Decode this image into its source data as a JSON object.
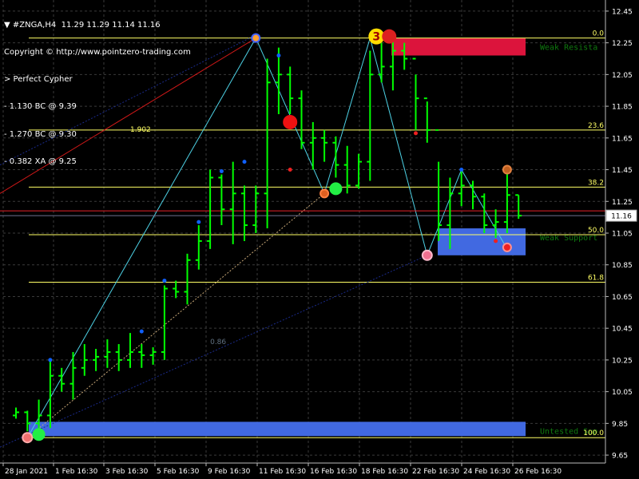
{
  "header": {
    "symbol_line": "#ZNGA,H4  11.29 11.29 11.14 11.16",
    "copyright": "Copyright © http://www.pointzero-trading.com",
    "pattern": "> Perfect Cypher",
    "lines": [
      "- 1.130 BC @ 9.39",
      "- 1.270 BC @ 9.30",
      "- 0.382 XA @ 9.25"
    ]
  },
  "colors": {
    "background": "#000000",
    "grid": "#3a3a3a",
    "candle": "#00ff00",
    "fib": "#ffff66",
    "price_line": "#e8202a",
    "resistance": "#dc143c",
    "support": "#4169e1",
    "zone_text": "#0f7a0f",
    "cyan": "#4dd2e6"
  },
  "chart_data": {
    "type": "candlestick",
    "symbol": "#ZNGA",
    "timeframe": "H4",
    "ohlc_header": {
      "open": 11.29,
      "high": 11.29,
      "low": 11.14,
      "close": 11.16
    },
    "current_price": 11.16,
    "ylim": [
      9.6,
      12.52
    ],
    "y_ticks": [
      12.45,
      12.25,
      12.05,
      11.85,
      11.65,
      11.45,
      11.25,
      11.05,
      10.85,
      10.65,
      10.45,
      10.25,
      10.05,
      9.85,
      9.65
    ],
    "x_ticks": [
      "28 Jan 2021",
      "1 Feb 16:30",
      "3 Feb 16:30",
      "5 Feb 16:30",
      "9 Feb 16:30",
      "11 Feb 16:30",
      "16 Feb 16:30",
      "18 Feb 16:30",
      "22 Feb 16:30",
      "24 Feb 16:30",
      "26 Feb 16:30"
    ],
    "fib_levels": [
      {
        "label": "0.0",
        "price": 12.28
      },
      {
        "label": "23.6",
        "price": 11.7
      },
      {
        "label": "38.2",
        "price": 11.34
      },
      {
        "label": "50.0",
        "price": 11.04
      },
      {
        "label": "61.8",
        "price": 10.74
      },
      {
        "label": "100.0",
        "price": 9.76
      }
    ],
    "zones": [
      {
        "text": "Weak Resista",
        "top": 12.28,
        "bottom": 12.17,
        "color": "resistance"
      },
      {
        "text": "Weak Support",
        "top": 11.08,
        "bottom": 10.91,
        "color": "support"
      },
      {
        "text": "Untested Sup",
        "top": 9.86,
        "bottom": 9.77,
        "color": "support"
      }
    ],
    "annotations": [
      {
        "text": "1.902",
        "x": 10,
        "price": 11.69
      },
      {
        "text": "0.86",
        "x": 17,
        "price": 10.35
      }
    ],
    "candles": [
      {
        "o": 9.9,
        "h": 9.95,
        "l": 9.88,
        "c": 9.92
      },
      {
        "o": 9.92,
        "h": 9.93,
        "l": 9.8,
        "c": 9.85
      },
      {
        "o": 9.85,
        "h": 10.0,
        "l": 9.75,
        "c": 9.9
      },
      {
        "o": 9.9,
        "h": 10.25,
        "l": 9.82,
        "c": 10.15
      },
      {
        "o": 10.15,
        "h": 10.2,
        "l": 10.05,
        "c": 10.1
      },
      {
        "o": 10.1,
        "h": 10.3,
        "l": 10.0,
        "c": 10.2
      },
      {
        "o": 10.2,
        "h": 10.35,
        "l": 10.15,
        "c": 10.25
      },
      {
        "o": 10.25,
        "h": 10.32,
        "l": 10.18,
        "c": 10.27
      },
      {
        "o": 10.27,
        "h": 10.38,
        "l": 10.2,
        "c": 10.3
      },
      {
        "o": 10.3,
        "h": 10.35,
        "l": 10.18,
        "c": 10.25
      },
      {
        "o": 10.25,
        "h": 10.42,
        "l": 10.2,
        "c": 10.3
      },
      {
        "o": 10.3,
        "h": 10.35,
        "l": 10.2,
        "c": 10.28
      },
      {
        "o": 10.28,
        "h": 10.33,
        "l": 10.22,
        "c": 10.3
      },
      {
        "o": 10.3,
        "h": 10.72,
        "l": 10.25,
        "c": 10.7
      },
      {
        "o": 10.7,
        "h": 10.75,
        "l": 10.64,
        "c": 10.68
      },
      {
        "o": 10.68,
        "h": 10.92,
        "l": 10.6,
        "c": 10.88
      },
      {
        "o": 10.88,
        "h": 11.1,
        "l": 10.82,
        "c": 11.0
      },
      {
        "o": 11.0,
        "h": 11.45,
        "l": 10.95,
        "c": 11.4
      },
      {
        "o": 11.4,
        "h": 11.42,
        "l": 11.1,
        "c": 11.2
      },
      {
        "o": 11.2,
        "h": 11.5,
        "l": 10.98,
        "c": 11.3
      },
      {
        "o": 11.3,
        "h": 11.35,
        "l": 11.0,
        "c": 11.1
      },
      {
        "o": 11.1,
        "h": 11.35,
        "l": 11.05,
        "c": 11.3
      },
      {
        "o": 11.3,
        "h": 12.15,
        "l": 11.08,
        "c": 12.0
      },
      {
        "o": 12.0,
        "h": 12.22,
        "l": 11.8,
        "c": 12.05
      },
      {
        "o": 12.05,
        "h": 12.1,
        "l": 11.8,
        "c": 11.9
      },
      {
        "o": 11.9,
        "h": 11.95,
        "l": 11.58,
        "c": 11.62
      },
      {
        "o": 11.62,
        "h": 11.75,
        "l": 11.45,
        "c": 11.65
      },
      {
        "o": 11.65,
        "h": 11.7,
        "l": 11.5,
        "c": 11.62
      },
      {
        "o": 11.62,
        "h": 11.66,
        "l": 11.4,
        "c": 11.48
      },
      {
        "o": 11.48,
        "h": 11.6,
        "l": 11.3,
        "c": 11.35
      },
      {
        "o": 11.35,
        "h": 11.55,
        "l": 11.33,
        "c": 11.5
      },
      {
        "o": 11.5,
        "h": 12.2,
        "l": 11.38,
        "c": 12.05
      },
      {
        "o": 12.05,
        "h": 12.25,
        "l": 12.0,
        "c": 12.1
      },
      {
        "o": 12.1,
        "h": 12.28,
        "l": 11.95,
        "c": 12.2
      },
      {
        "o": 12.2,
        "h": 12.25,
        "l": 12.08,
        "c": 12.15
      },
      {
        "o": 12.15,
        "h": 12.05,
        "l": 11.7,
        "c": 11.9
      },
      {
        "o": 11.9,
        "h": 11.88,
        "l": 11.62,
        "c": 11.7
      },
      {
        "o": 11.7,
        "h": 11.5,
        "l": 11.0,
        "c": 11.1
      },
      {
        "o": 11.1,
        "h": 11.4,
        "l": 10.95,
        "c": 11.3
      },
      {
        "o": 11.3,
        "h": 11.45,
        "l": 11.22,
        "c": 11.35
      },
      {
        "o": 11.35,
        "h": 11.38,
        "l": 11.2,
        "c": 11.28
      },
      {
        "o": 11.28,
        "h": 11.3,
        "l": 11.05,
        "c": 11.1
      },
      {
        "o": 11.1,
        "h": 11.2,
        "l": 11.02,
        "c": 11.12
      },
      {
        "o": 11.12,
        "h": 11.45,
        "l": 11.05,
        "c": 11.29
      },
      {
        "o": 11.29,
        "h": 11.29,
        "l": 11.14,
        "c": 11.16
      }
    ],
    "pattern_lines": [
      {
        "from": [
          1,
          9.76
        ],
        "to": [
          21,
          12.28
        ]
      },
      {
        "from": [
          21,
          12.28
        ],
        "to": [
          27,
          11.3
        ]
      },
      {
        "from": [
          27,
          11.3
        ],
        "to": [
          31,
          12.28
        ]
      },
      {
        "from": [
          31,
          12.28
        ],
        "to": [
          36,
          10.91
        ]
      },
      {
        "from": [
          36,
          10.91
        ],
        "to": [
          39,
          11.45
        ]
      },
      {
        "from": [
          39,
          11.45
        ],
        "to": [
          43,
          10.95
        ]
      }
    ]
  }
}
